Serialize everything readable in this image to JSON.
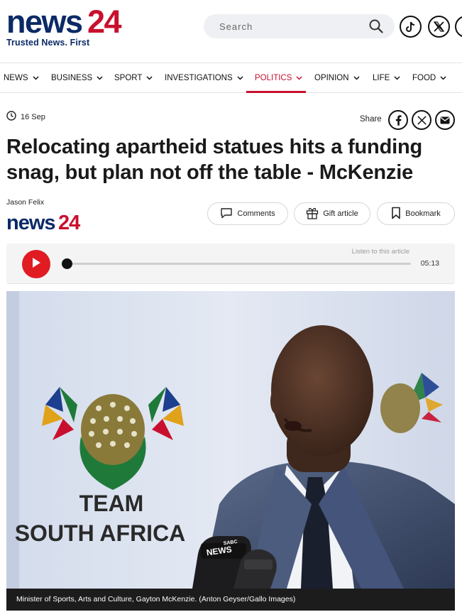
{
  "header": {
    "logo_text_main": "news",
    "logo_text_num": "24",
    "tagline": "Trusted News. First",
    "search_placeholder": "Search",
    "social": [
      "tiktok-icon",
      "x-icon",
      "facebook-icon"
    ]
  },
  "nav": {
    "items": [
      {
        "label": "NEWS",
        "active": false
      },
      {
        "label": "BUSINESS",
        "active": false
      },
      {
        "label": "SPORT",
        "active": false
      },
      {
        "label": "INVESTIGATIONS",
        "active": false
      },
      {
        "label": "POLITICS",
        "active": true
      },
      {
        "label": "OPINION",
        "active": false
      },
      {
        "label": "LIFE",
        "active": false
      },
      {
        "label": "FOOD",
        "active": false
      }
    ]
  },
  "article": {
    "date": "16 Sep",
    "share_label": "Share",
    "title": "Relocating apartheid statues hits a funding snag, but plan not off the table - McKenzie",
    "author": "Jason Felix",
    "publisher_main": "news",
    "publisher_num": "24",
    "actions": {
      "comments": "Comments",
      "gift": "Gift article",
      "bookmark": "Bookmark"
    }
  },
  "player": {
    "listen_label": "Listen to this article",
    "duration": "05:13",
    "progress": 0
  },
  "photo": {
    "banner_line1": "TEAM",
    "banner_line2": "SOUTH AFRICA",
    "mic_label": "NEWS",
    "mic_brand": "SABC",
    "caption": "Minister of Sports, Arts and Culture, Gayton McKenzie. (Anton Geyser/Gallo Images)"
  },
  "colors": {
    "brand_blue": "#0b2a66",
    "brand_red": "#c8102e",
    "play_red": "#e01b22"
  }
}
